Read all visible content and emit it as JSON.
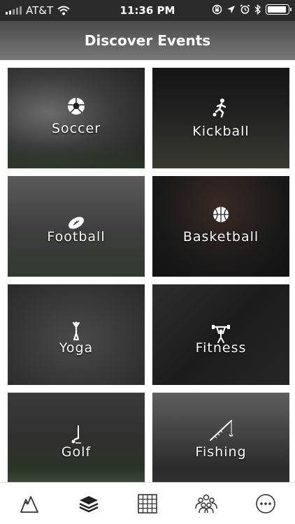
{
  "status_bar": {
    "carrier": "AT&T",
    "time": "11:36 PM"
  },
  "header": {
    "title": "Discover Events"
  },
  "categories": [
    {
      "label": "Soccer",
      "icon": "soccer-ball-icon"
    },
    {
      "label": "Kickball",
      "icon": "kicking-player-icon"
    },
    {
      "label": "Football",
      "icon": "football-icon"
    },
    {
      "label": "Basketball",
      "icon": "basketball-icon"
    },
    {
      "label": "Yoga",
      "icon": "yoga-pose-icon"
    },
    {
      "label": "Fitness",
      "icon": "weightlifter-icon"
    },
    {
      "label": "Golf",
      "icon": "golf-club-ball-icon"
    },
    {
      "label": "Fishing",
      "icon": "fishing-rod-icon"
    }
  ],
  "tabbar": {
    "tabs": [
      {
        "icon": "mountains-icon"
      },
      {
        "icon": "layers-icon"
      },
      {
        "icon": "grid-icon"
      },
      {
        "icon": "people-group-icon"
      },
      {
        "icon": "more-dots-icon"
      }
    ]
  }
}
